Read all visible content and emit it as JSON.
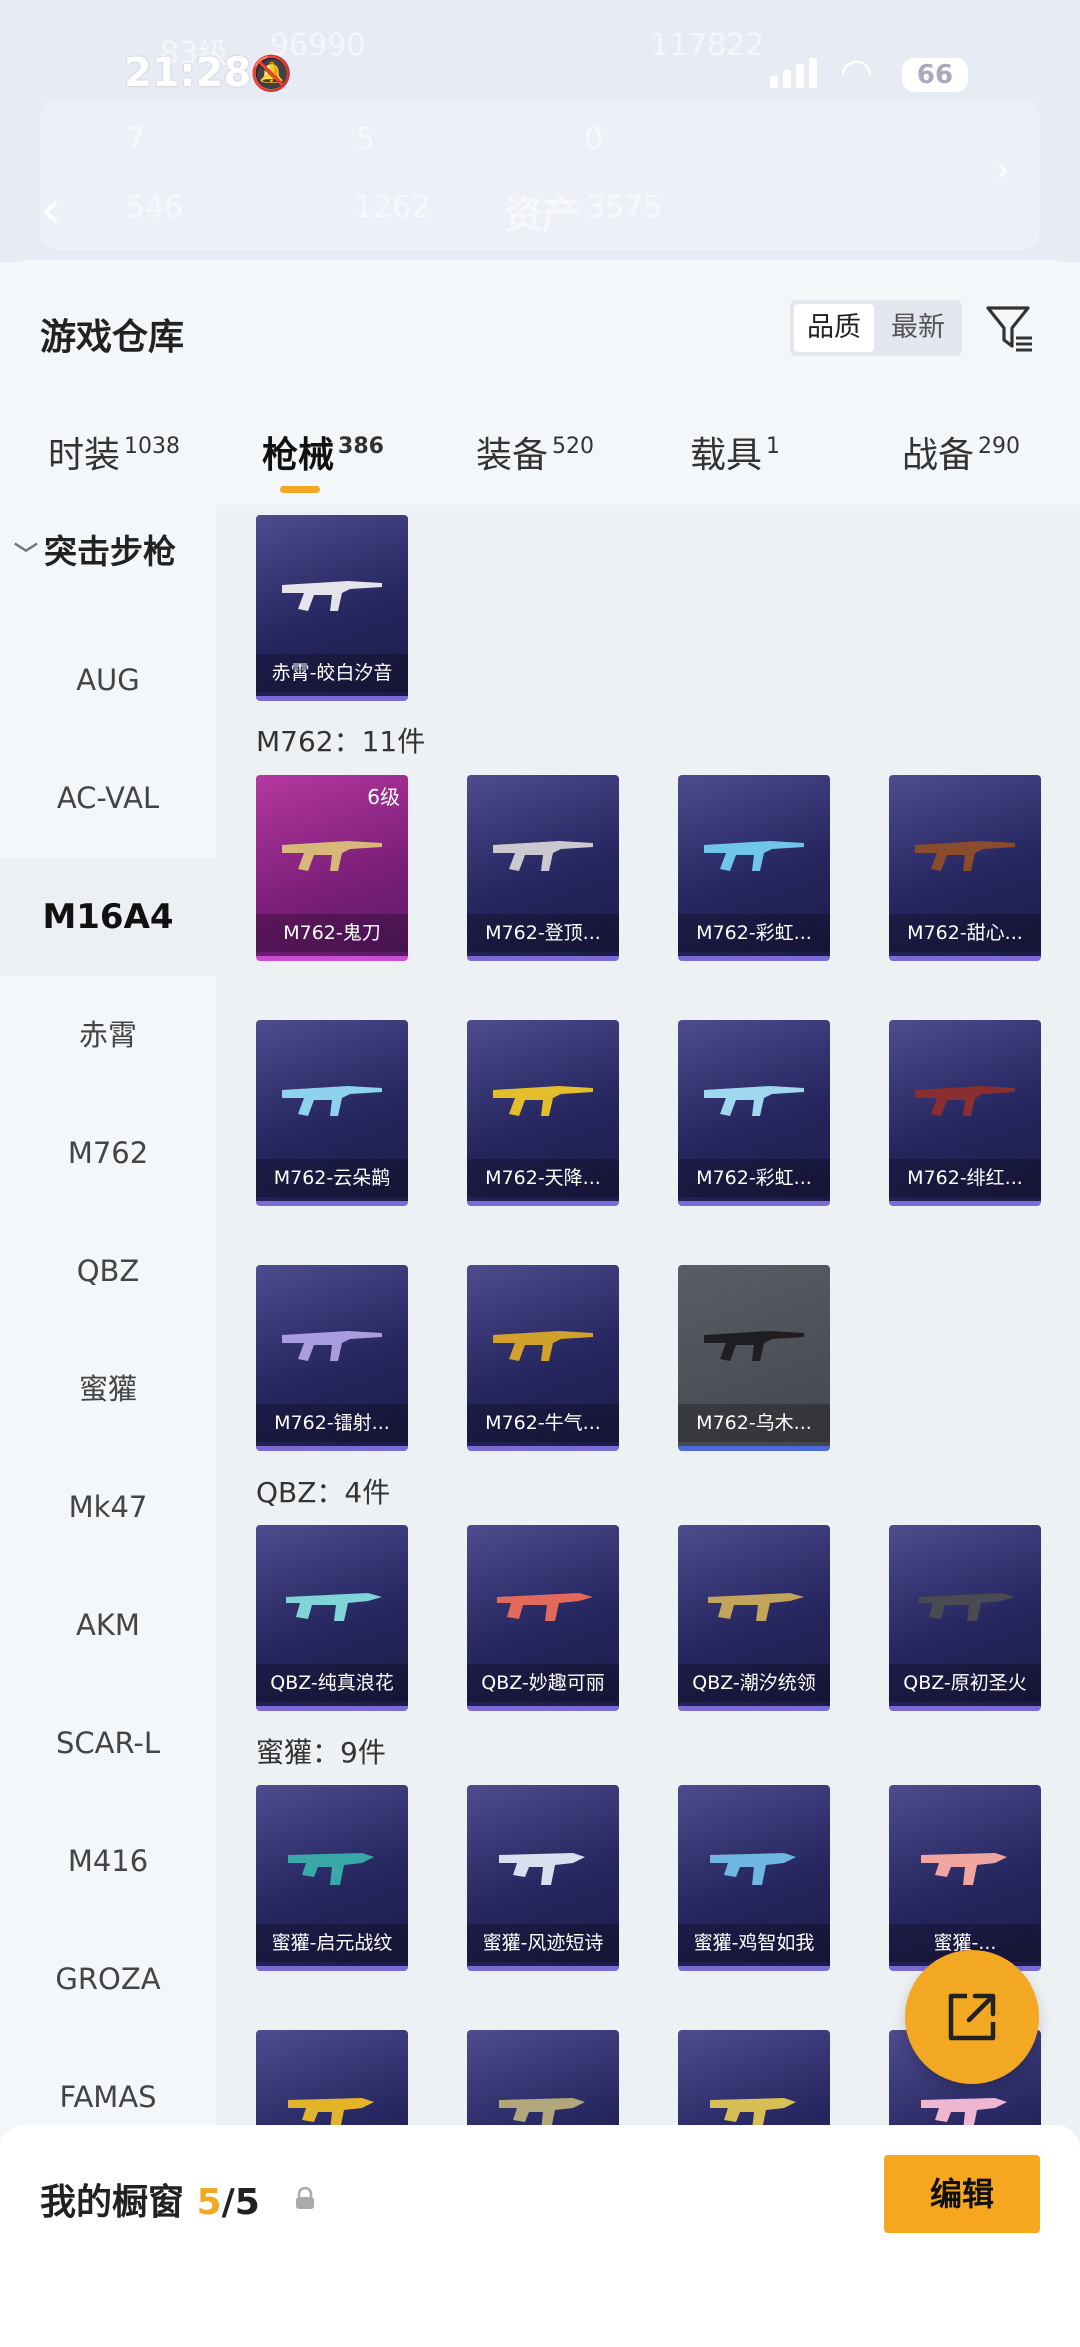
{
  "status_bar": {
    "time": "21:28",
    "battery": "66"
  },
  "background_header": {
    "level": "83级",
    "coins": "96990",
    "score": "117822",
    "stat1": "7",
    "stat2": "5",
    "stat3": "0",
    "stat4": "546",
    "stat5": "1262",
    "assets_label": "资产",
    "assets_value": "3575"
  },
  "warehouse": {
    "title": "游戏仓库",
    "sort": {
      "active": "品质",
      "other": "最新"
    }
  },
  "tabs": [
    {
      "label": "时装",
      "count": "1038"
    },
    {
      "label": "枪械",
      "count": "386"
    },
    {
      "label": "装备",
      "count": "520"
    },
    {
      "label": "载具",
      "count": "1"
    },
    {
      "label": "战备",
      "count": "290"
    }
  ],
  "sidebar": {
    "header": "突击步枪",
    "items": [
      "AUG",
      "AC-VAL",
      "M16A4",
      "赤霄",
      "M762",
      "QBZ",
      "蜜獾",
      "Mk47",
      "AKM",
      "SCAR-L",
      "M416",
      "GROZA",
      "FAMAS"
    ],
    "active": "M16A4"
  },
  "groups": [
    {
      "label": "M762：11件"
    },
    {
      "label": "QBZ：4件"
    },
    {
      "label": "蜜獾：9件"
    }
  ],
  "items": {
    "chixiao": "赤霄-皎白汐音",
    "m762": [
      "M762-鬼刀",
      "M762-登顶...",
      "M762-彩虹...",
      "M762-甜心...",
      "M762-云朵鹋",
      "M762-天降...",
      "M762-彩虹...",
      "M762-绯红...",
      "M762-镭射...",
      "M762-牛气...",
      "M762-乌木..."
    ],
    "m762_level": "6级",
    "qbz": [
      "QBZ-纯真浪花",
      "QBZ-妙趣可丽",
      "QBZ-潮汐统领",
      "QBZ-原初圣火"
    ],
    "mihuan": [
      "蜜獾-启元战纹",
      "蜜獾-风迹短诗",
      "蜜獾-鸡智如我",
      "蜜獾-..."
    ]
  },
  "colors": {
    "accent": "#f3a823",
    "card_blue": "#262660",
    "card_purple": "#7a1e78"
  },
  "showcase": {
    "label": "我的橱窗",
    "current": "5",
    "total": "/5"
  },
  "edit_button": "编辑"
}
